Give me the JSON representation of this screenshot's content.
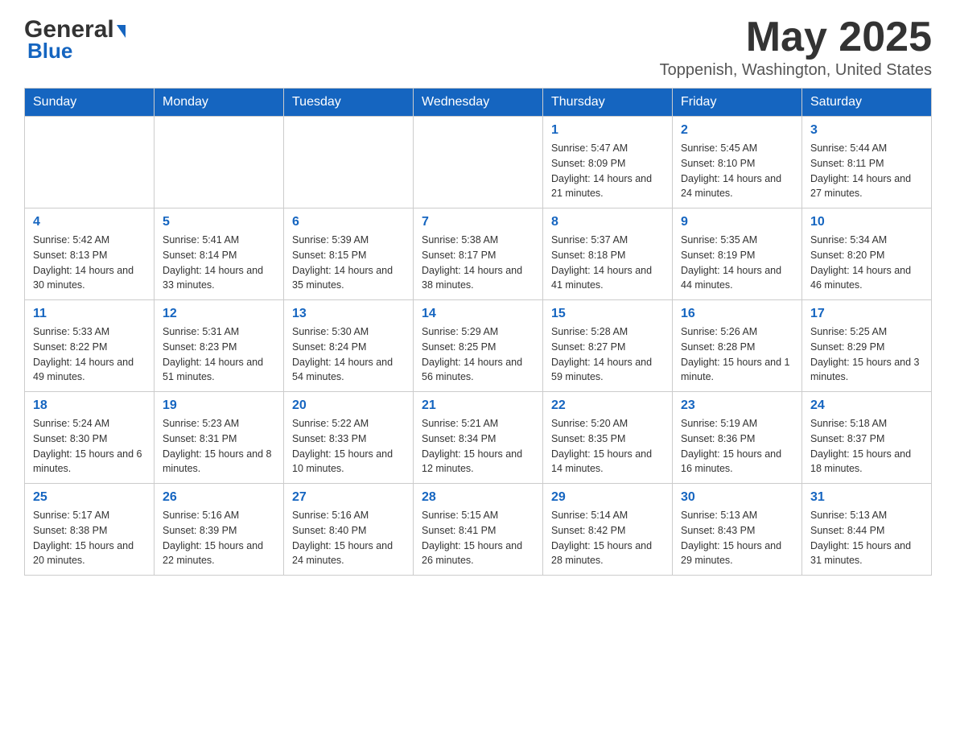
{
  "header": {
    "logo_main": "General",
    "logo_sub": "Blue",
    "month_year": "May 2025",
    "location": "Toppenish, Washington, United States"
  },
  "days_of_week": [
    "Sunday",
    "Monday",
    "Tuesday",
    "Wednesday",
    "Thursday",
    "Friday",
    "Saturday"
  ],
  "weeks": [
    [
      {
        "day": "",
        "info": ""
      },
      {
        "day": "",
        "info": ""
      },
      {
        "day": "",
        "info": ""
      },
      {
        "day": "",
        "info": ""
      },
      {
        "day": "1",
        "info": "Sunrise: 5:47 AM\nSunset: 8:09 PM\nDaylight: 14 hours and 21 minutes."
      },
      {
        "day": "2",
        "info": "Sunrise: 5:45 AM\nSunset: 8:10 PM\nDaylight: 14 hours and 24 minutes."
      },
      {
        "day": "3",
        "info": "Sunrise: 5:44 AM\nSunset: 8:11 PM\nDaylight: 14 hours and 27 minutes."
      }
    ],
    [
      {
        "day": "4",
        "info": "Sunrise: 5:42 AM\nSunset: 8:13 PM\nDaylight: 14 hours and 30 minutes."
      },
      {
        "day": "5",
        "info": "Sunrise: 5:41 AM\nSunset: 8:14 PM\nDaylight: 14 hours and 33 minutes."
      },
      {
        "day": "6",
        "info": "Sunrise: 5:39 AM\nSunset: 8:15 PM\nDaylight: 14 hours and 35 minutes."
      },
      {
        "day": "7",
        "info": "Sunrise: 5:38 AM\nSunset: 8:17 PM\nDaylight: 14 hours and 38 minutes."
      },
      {
        "day": "8",
        "info": "Sunrise: 5:37 AM\nSunset: 8:18 PM\nDaylight: 14 hours and 41 minutes."
      },
      {
        "day": "9",
        "info": "Sunrise: 5:35 AM\nSunset: 8:19 PM\nDaylight: 14 hours and 44 minutes."
      },
      {
        "day": "10",
        "info": "Sunrise: 5:34 AM\nSunset: 8:20 PM\nDaylight: 14 hours and 46 minutes."
      }
    ],
    [
      {
        "day": "11",
        "info": "Sunrise: 5:33 AM\nSunset: 8:22 PM\nDaylight: 14 hours and 49 minutes."
      },
      {
        "day": "12",
        "info": "Sunrise: 5:31 AM\nSunset: 8:23 PM\nDaylight: 14 hours and 51 minutes."
      },
      {
        "day": "13",
        "info": "Sunrise: 5:30 AM\nSunset: 8:24 PM\nDaylight: 14 hours and 54 minutes."
      },
      {
        "day": "14",
        "info": "Sunrise: 5:29 AM\nSunset: 8:25 PM\nDaylight: 14 hours and 56 minutes."
      },
      {
        "day": "15",
        "info": "Sunrise: 5:28 AM\nSunset: 8:27 PM\nDaylight: 14 hours and 59 minutes."
      },
      {
        "day": "16",
        "info": "Sunrise: 5:26 AM\nSunset: 8:28 PM\nDaylight: 15 hours and 1 minute."
      },
      {
        "day": "17",
        "info": "Sunrise: 5:25 AM\nSunset: 8:29 PM\nDaylight: 15 hours and 3 minutes."
      }
    ],
    [
      {
        "day": "18",
        "info": "Sunrise: 5:24 AM\nSunset: 8:30 PM\nDaylight: 15 hours and 6 minutes."
      },
      {
        "day": "19",
        "info": "Sunrise: 5:23 AM\nSunset: 8:31 PM\nDaylight: 15 hours and 8 minutes."
      },
      {
        "day": "20",
        "info": "Sunrise: 5:22 AM\nSunset: 8:33 PM\nDaylight: 15 hours and 10 minutes."
      },
      {
        "day": "21",
        "info": "Sunrise: 5:21 AM\nSunset: 8:34 PM\nDaylight: 15 hours and 12 minutes."
      },
      {
        "day": "22",
        "info": "Sunrise: 5:20 AM\nSunset: 8:35 PM\nDaylight: 15 hours and 14 minutes."
      },
      {
        "day": "23",
        "info": "Sunrise: 5:19 AM\nSunset: 8:36 PM\nDaylight: 15 hours and 16 minutes."
      },
      {
        "day": "24",
        "info": "Sunrise: 5:18 AM\nSunset: 8:37 PM\nDaylight: 15 hours and 18 minutes."
      }
    ],
    [
      {
        "day": "25",
        "info": "Sunrise: 5:17 AM\nSunset: 8:38 PM\nDaylight: 15 hours and 20 minutes."
      },
      {
        "day": "26",
        "info": "Sunrise: 5:16 AM\nSunset: 8:39 PM\nDaylight: 15 hours and 22 minutes."
      },
      {
        "day": "27",
        "info": "Sunrise: 5:16 AM\nSunset: 8:40 PM\nDaylight: 15 hours and 24 minutes."
      },
      {
        "day": "28",
        "info": "Sunrise: 5:15 AM\nSunset: 8:41 PM\nDaylight: 15 hours and 26 minutes."
      },
      {
        "day": "29",
        "info": "Sunrise: 5:14 AM\nSunset: 8:42 PM\nDaylight: 15 hours and 28 minutes."
      },
      {
        "day": "30",
        "info": "Sunrise: 5:13 AM\nSunset: 8:43 PM\nDaylight: 15 hours and 29 minutes."
      },
      {
        "day": "31",
        "info": "Sunrise: 5:13 AM\nSunset: 8:44 PM\nDaylight: 15 hours and 31 minutes."
      }
    ]
  ]
}
